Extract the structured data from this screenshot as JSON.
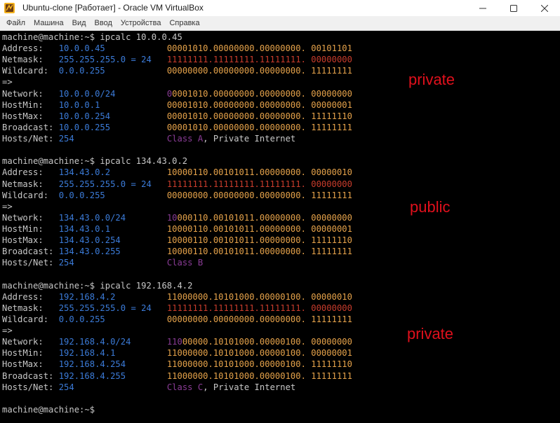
{
  "window": {
    "title": "Ubuntu-clone [Работает] - Oracle VM VirtualBox",
    "controls": {
      "minimize_icon": "minimize-icon",
      "maximize_icon": "maximize-icon",
      "close_icon": "close-icon"
    }
  },
  "menu": {
    "items": [
      "Файл",
      "Машина",
      "Вид",
      "Ввод",
      "Устройства",
      "Справка"
    ]
  },
  "colors": {
    "terminal_bg": "#000000",
    "text": "#c8c8c8",
    "value_blue": "#3b7bd8",
    "binary_orange": "#e5a24a",
    "netmask_red": "#c83c2c",
    "class_purple": "#8a3c96",
    "annotation_red": "#e0101c"
  },
  "terminal": {
    "lines": [
      [
        {
          "t": "machine@machine:~$ ipcalc 10.0.0.45",
          "c": "w"
        }
      ],
      [
        {
          "t": "Address:   ",
          "c": "w"
        },
        {
          "t": "10.0.0.45            ",
          "c": "b"
        },
        {
          "t": "00001010.00000000.00000000. 00101101",
          "c": "o"
        }
      ],
      [
        {
          "t": "Netmask:   ",
          "c": "w"
        },
        {
          "t": "255.255.255.0 = 24   ",
          "c": "b"
        },
        {
          "t": "11111111.11111111.11111111. 00000000",
          "c": "r"
        }
      ],
      [
        {
          "t": "Wildcard:  ",
          "c": "w"
        },
        {
          "t": "0.0.0.255            ",
          "c": "b"
        },
        {
          "t": "00000000.00000000.00000000. 11111111",
          "c": "o"
        }
      ],
      [
        {
          "t": "=>",
          "c": "w"
        }
      ],
      [
        {
          "t": "Network:   ",
          "c": "w"
        },
        {
          "t": "10.0.0.0/24          ",
          "c": "b"
        },
        {
          "t": "0",
          "c": "p"
        },
        {
          "t": "0001010.00000000.00000000. 00000000",
          "c": "o"
        }
      ],
      [
        {
          "t": "HostMin:   ",
          "c": "w"
        },
        {
          "t": "10.0.0.1             ",
          "c": "b"
        },
        {
          "t": "00001010.00000000.00000000. 00000001",
          "c": "o"
        }
      ],
      [
        {
          "t": "HostMax:   ",
          "c": "w"
        },
        {
          "t": "10.0.0.254           ",
          "c": "b"
        },
        {
          "t": "00001010.00000000.00000000. 11111110",
          "c": "o"
        }
      ],
      [
        {
          "t": "Broadcast: ",
          "c": "w"
        },
        {
          "t": "10.0.0.255           ",
          "c": "b"
        },
        {
          "t": "00001010.00000000.00000000. 11111111",
          "c": "o"
        }
      ],
      [
        {
          "t": "Hosts/Net: ",
          "c": "w"
        },
        {
          "t": "254                  ",
          "c": "b"
        },
        {
          "t": "Class A",
          "c": "p"
        },
        {
          "t": ", Private Internet",
          "c": "w"
        }
      ],
      [],
      [
        {
          "t": "machine@machine:~$ ipcalc 134.43.0.2",
          "c": "w"
        }
      ],
      [
        {
          "t": "Address:   ",
          "c": "w"
        },
        {
          "t": "134.43.0.2           ",
          "c": "b"
        },
        {
          "t": "10000110.00101011.00000000. 00000010",
          "c": "o"
        }
      ],
      [
        {
          "t": "Netmask:   ",
          "c": "w"
        },
        {
          "t": "255.255.255.0 = 24   ",
          "c": "b"
        },
        {
          "t": "11111111.11111111.11111111. 00000000",
          "c": "r"
        }
      ],
      [
        {
          "t": "Wildcard:  ",
          "c": "w"
        },
        {
          "t": "0.0.0.255            ",
          "c": "b"
        },
        {
          "t": "00000000.00000000.00000000. 11111111",
          "c": "o"
        }
      ],
      [
        {
          "t": "=>",
          "c": "w"
        }
      ],
      [
        {
          "t": "Network:   ",
          "c": "w"
        },
        {
          "t": "134.43.0.0/24        ",
          "c": "b"
        },
        {
          "t": "10",
          "c": "p"
        },
        {
          "t": "000110.00101011.00000000. 00000000",
          "c": "o"
        }
      ],
      [
        {
          "t": "HostMin:   ",
          "c": "w"
        },
        {
          "t": "134.43.0.1           ",
          "c": "b"
        },
        {
          "t": "10000110.00101011.00000000. 00000001",
          "c": "o"
        }
      ],
      [
        {
          "t": "HostMax:   ",
          "c": "w"
        },
        {
          "t": "134.43.0.254         ",
          "c": "b"
        },
        {
          "t": "10000110.00101011.00000000. 11111110",
          "c": "o"
        }
      ],
      [
        {
          "t": "Broadcast: ",
          "c": "w"
        },
        {
          "t": "134.43.0.255         ",
          "c": "b"
        },
        {
          "t": "10000110.00101011.00000000. 11111111",
          "c": "o"
        }
      ],
      [
        {
          "t": "Hosts/Net: ",
          "c": "w"
        },
        {
          "t": "254                  ",
          "c": "b"
        },
        {
          "t": "Class B",
          "c": "p"
        }
      ],
      [],
      [
        {
          "t": "machine@machine:~$ ipcalc 192.168.4.2",
          "c": "w"
        }
      ],
      [
        {
          "t": "Address:   ",
          "c": "w"
        },
        {
          "t": "192.168.4.2          ",
          "c": "b"
        },
        {
          "t": "11000000.10101000.00000100. 00000010",
          "c": "o"
        }
      ],
      [
        {
          "t": "Netmask:   ",
          "c": "w"
        },
        {
          "t": "255.255.255.0 = 24   ",
          "c": "b"
        },
        {
          "t": "11111111.11111111.11111111. 00000000",
          "c": "r"
        }
      ],
      [
        {
          "t": "Wildcard:  ",
          "c": "w"
        },
        {
          "t": "0.0.0.255            ",
          "c": "b"
        },
        {
          "t": "00000000.00000000.00000000. 11111111",
          "c": "o"
        }
      ],
      [
        {
          "t": "=>",
          "c": "w"
        }
      ],
      [
        {
          "t": "Network:   ",
          "c": "w"
        },
        {
          "t": "192.168.4.0/24       ",
          "c": "b"
        },
        {
          "t": "110",
          "c": "p"
        },
        {
          "t": "00000.10101000.00000100. 00000000",
          "c": "o"
        }
      ],
      [
        {
          "t": "HostMin:   ",
          "c": "w"
        },
        {
          "t": "192.168.4.1          ",
          "c": "b"
        },
        {
          "t": "11000000.10101000.00000100. 00000001",
          "c": "o"
        }
      ],
      [
        {
          "t": "HostMax:   ",
          "c": "w"
        },
        {
          "t": "192.168.4.254        ",
          "c": "b"
        },
        {
          "t": "11000000.10101000.00000100. 11111110",
          "c": "o"
        }
      ],
      [
        {
          "t": "Broadcast: ",
          "c": "w"
        },
        {
          "t": "192.168.4.255        ",
          "c": "b"
        },
        {
          "t": "11000000.10101000.00000100. 11111111",
          "c": "o"
        }
      ],
      [
        {
          "t": "Hosts/Net: ",
          "c": "w"
        },
        {
          "t": "254                  ",
          "c": "b"
        },
        {
          "t": "Class C",
          "c": "p"
        },
        {
          "t": ", Private Internet",
          "c": "w"
        }
      ],
      [],
      [
        {
          "t": "machine@machine:~$",
          "c": "w"
        }
      ]
    ]
  },
  "annotations": [
    "private",
    "public",
    "private"
  ]
}
